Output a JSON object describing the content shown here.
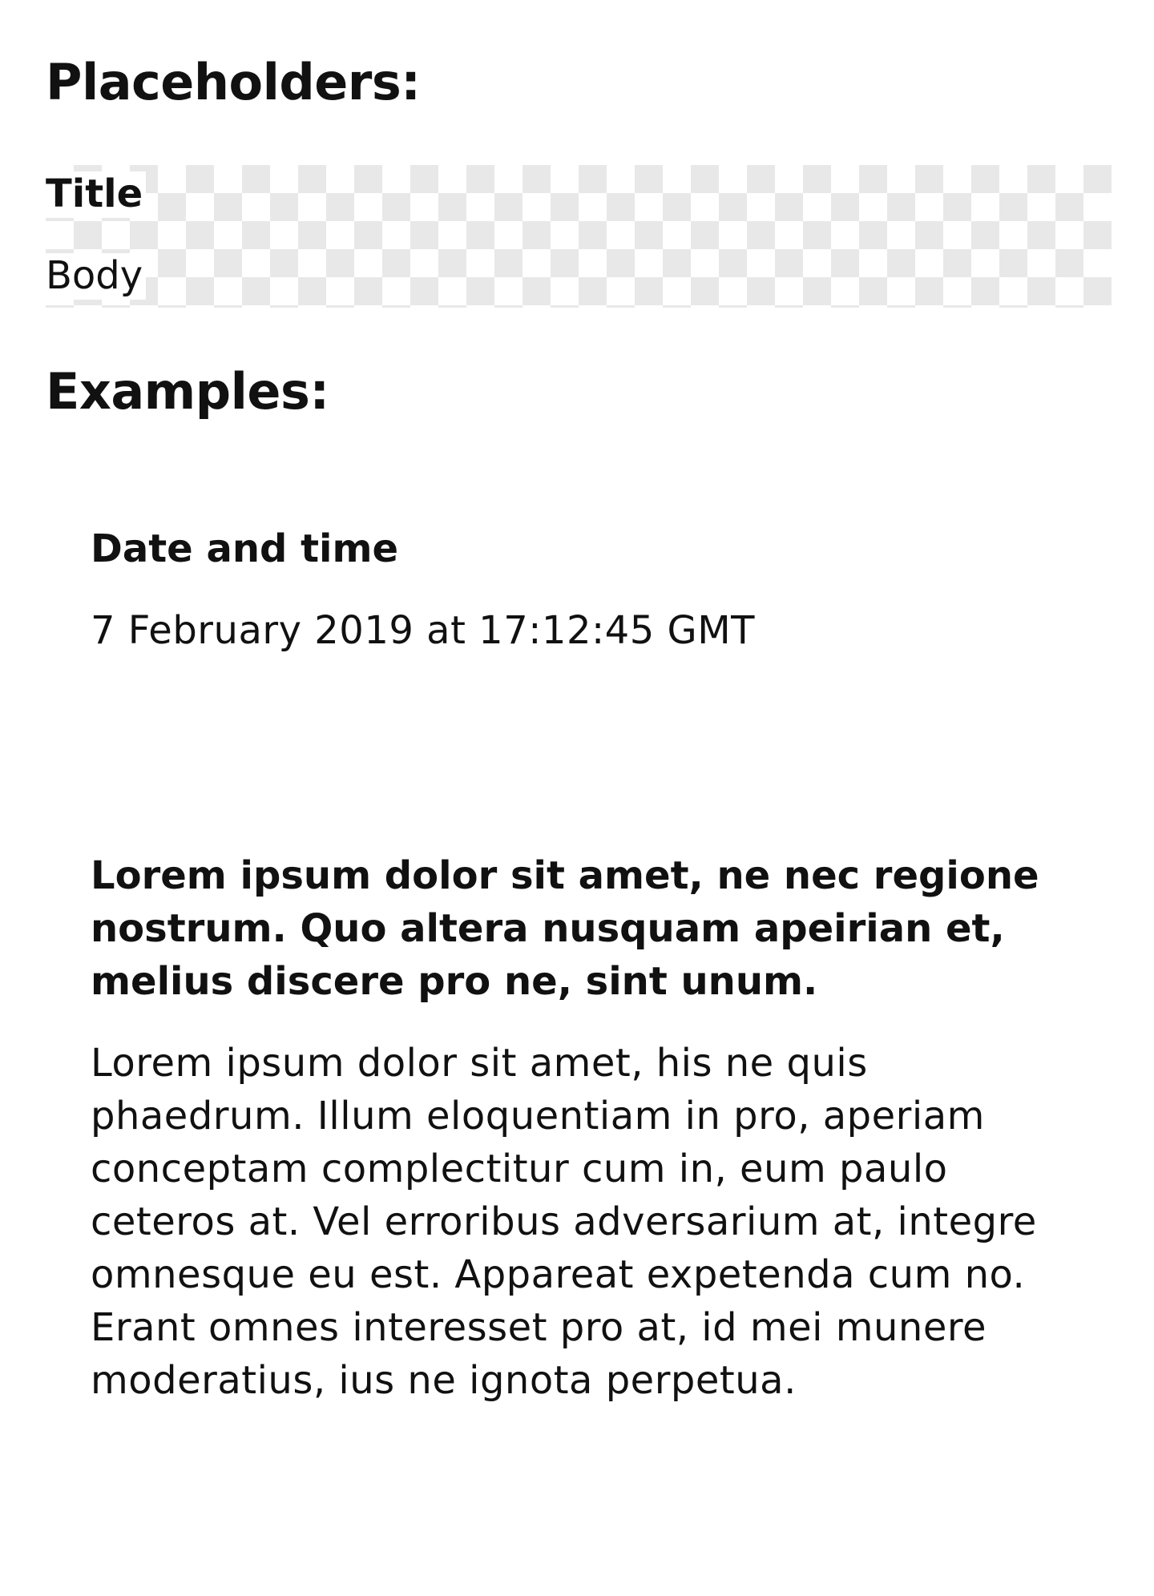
{
  "placeholders": {
    "heading": "Placeholders:",
    "title": "Title",
    "body": "Body"
  },
  "examples": {
    "heading": "Examples:",
    "items": [
      {
        "title": "Date and time",
        "body": "7 February 2019 at 17:12:45 GMT"
      },
      {
        "title": "Lorem ipsum dolor sit amet, ne nec regione nostrum. Quo altera nusquam apeirian et, melius discere pro ne, sint unum.",
        "body": "Lorem ipsum dolor sit amet, his ne quis phaedrum. Illum eloquentiam in pro, aperiam conceptam complectitur cum in, eum paulo ceteros at. Vel erroribus adversarium at, integre omnesque eu est. Appareat expetenda cum no. Erant omnes interesset pro at, id mei munere moderatius, ius ne ignota perpetua."
      }
    ]
  },
  "colors": {
    "text": "#111111",
    "background": "#ffffff",
    "checker": "#e8e8e8"
  }
}
